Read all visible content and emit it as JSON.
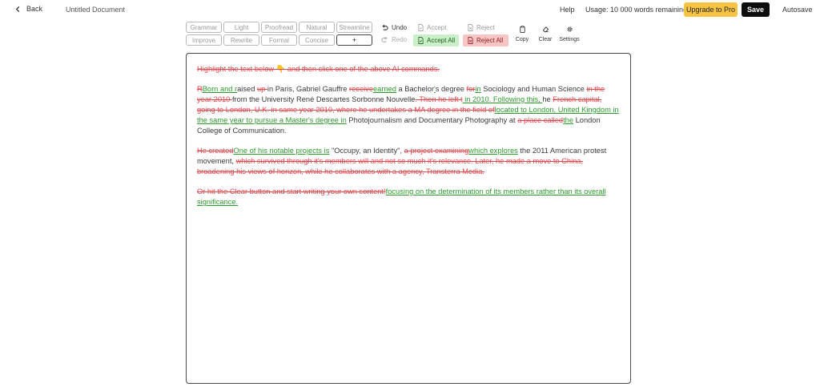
{
  "header": {
    "back_label": "Back",
    "doc_title": "Untitled Document",
    "help_label": "Help",
    "usage_text": "Usage: 10 000 words remaining",
    "upgrade_label": "Upgrade to Pro",
    "save_label": "Save",
    "autosave_label": "Autosave"
  },
  "ai_commands": [
    "Grammar",
    "Light",
    "Proofread",
    "Natural",
    "Streamline",
    "Improve",
    "Rewrite",
    "Formal",
    "Concise",
    "+"
  ],
  "history": {
    "undo_label": "Undo",
    "redo_label": "Redo"
  },
  "review": {
    "accept_label": "Accept",
    "reject_label": "Reject",
    "accept_all_label": "Accept All",
    "reject_all_label": "Reject All"
  },
  "tools": {
    "copy_label": "Copy",
    "clear_label": "Clear",
    "settings_label": "Settings"
  },
  "colors": {
    "deleted": "#e0474c",
    "inserted": "#2e9a2e",
    "upgrade": "#f6c443",
    "accept_bg": "#c9f0c9",
    "reject_bg": "#f8c5c5"
  },
  "editor": {
    "paragraphs": [
      [
        {
          "t": "del",
          "s": "Highlight the text below 👇 and then click one of the above AI commands."
        }
      ],
      [
        {
          "t": "del",
          "s": "R"
        },
        {
          "t": "ins",
          "s": "Born and r"
        },
        {
          "t": "n",
          "s": "aised "
        },
        {
          "t": "del",
          "s": "up "
        },
        {
          "t": "n",
          "s": "in Paris, Gabriel Gauffre "
        },
        {
          "t": "del",
          "s": "receive"
        },
        {
          "t": "ins",
          "s": "earned"
        },
        {
          "t": "n",
          "s": " a Bachelor"
        },
        {
          "t": "ins",
          "s": "'"
        },
        {
          "t": "n",
          "s": "s degree "
        },
        {
          "t": "del",
          "s": "for"
        },
        {
          "t": "ins",
          "s": "in"
        },
        {
          "t": "n",
          "s": " Sociology and Human Science "
        },
        {
          "t": "del",
          "s": "in the year 2010 "
        },
        {
          "t": "n",
          "s": "from the University René Descartes Sorbonne Nouvelle"
        },
        {
          "t": "del",
          "s": ". Then he left t"
        },
        {
          "t": "ins",
          "s": " in 2010. Following this, "
        },
        {
          "t": "n",
          "s": "he "
        },
        {
          "t": "del",
          "s": "French capital, going to London, U.K. in same year 2010, where he undertakes a MA degree in the field of"
        },
        {
          "t": "ins",
          "s": "located to London, United Kingdom in the same year to pursue a Master's degree in"
        },
        {
          "t": "n",
          "s": " Photojournalism and Documentary Photography at "
        },
        {
          "t": "del",
          "s": "a place called"
        },
        {
          "t": "ins",
          "s": "the"
        },
        {
          "t": "n",
          "s": " London College of Communication."
        }
      ],
      [
        {
          "t": "del",
          "s": "He created"
        },
        {
          "t": "ins",
          "s": "One of his notable projects is"
        },
        {
          "t": "n",
          "s": " \"Occupy, an Identity\", "
        },
        {
          "t": "del",
          "s": "a project examining"
        },
        {
          "t": "ins",
          "s": "which explores"
        },
        {
          "t": "n",
          "s": " the 2011 American protest movement, "
        },
        {
          "t": "del",
          "s": "which survived through it's members will and not so much it's relevance. Later, he made a move to China, broadening his views of horizon, while he collaborates with a agency, Transterra Media."
        }
      ],
      [
        {
          "t": "del",
          "s": "Or hit the Clear button and start writing your own content!"
        },
        {
          "t": "ins",
          "s": "focusing on the determination of its members rather than its overall significance."
        }
      ]
    ]
  }
}
